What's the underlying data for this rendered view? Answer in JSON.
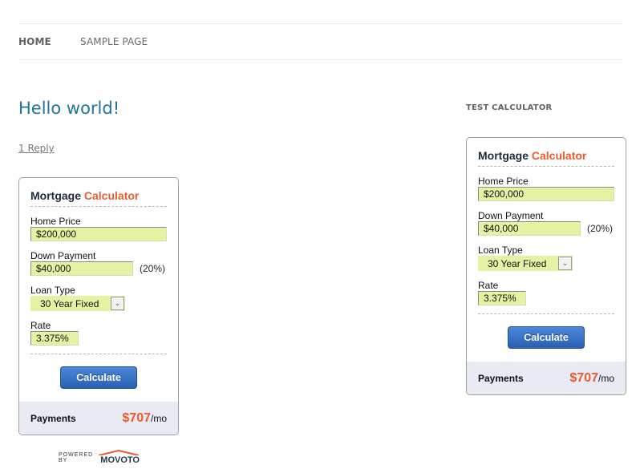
{
  "nav": {
    "items": [
      {
        "label": "HOME",
        "active": true
      },
      {
        "label": "SAMPLE PAGE",
        "active": false
      }
    ]
  },
  "post": {
    "title": "Hello world!",
    "reply_link": "1 Reply"
  },
  "sidebar": {
    "widget_title": "TEST CALCULATOR"
  },
  "calculator": {
    "title_part1": "Mortgage",
    "title_part2": "Calculator",
    "home_price_label": "Home Price",
    "home_price_value": "$200,000",
    "down_payment_label": "Down Payment",
    "down_payment_value": "$40,000",
    "down_payment_percent": "(20%)",
    "loan_type_label": "Loan Type",
    "loan_type_selected": "30 Year Fixed",
    "rate_label": "Rate",
    "rate_value": "3.375%",
    "calculate_button": "Calculate",
    "payments_label": "Payments",
    "payment_amount": "$707",
    "payment_period": "/mo"
  },
  "powered_by": {
    "text": "POWERED BY",
    "brand": "MOVOTO"
  },
  "colors": {
    "accent": "#ee5a2c",
    "link": "#21759b",
    "field_bg": "#e4f2a4",
    "button": "#2a5fb3",
    "payments_bg": "#e8ebf4"
  }
}
